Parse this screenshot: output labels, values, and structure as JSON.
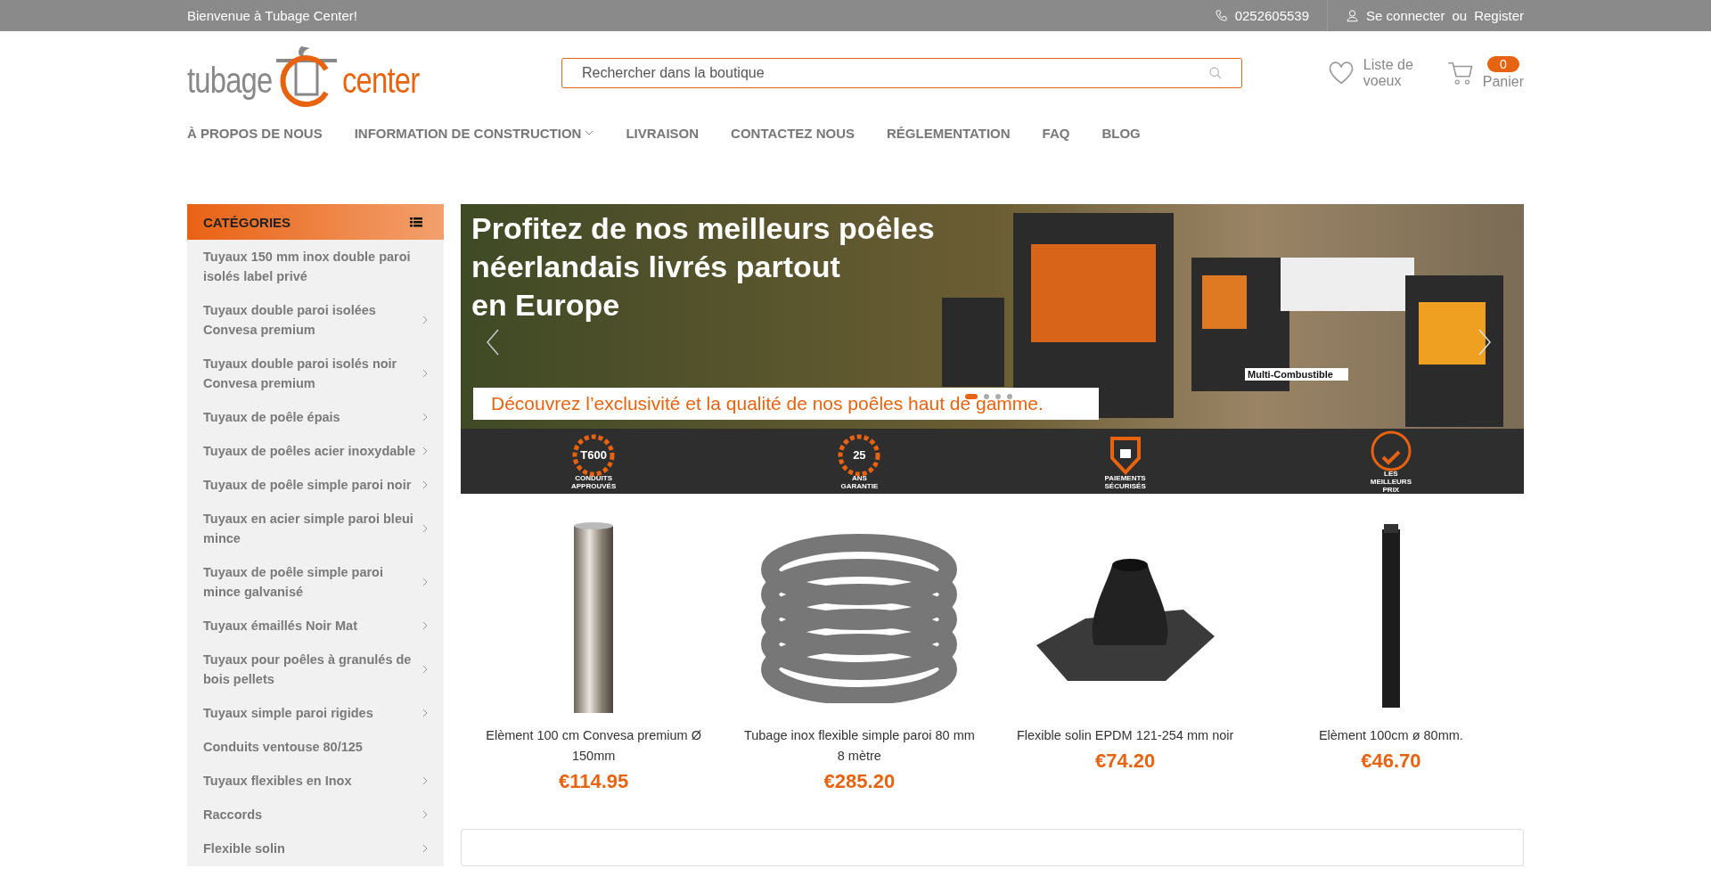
{
  "topbar": {
    "welcome": "Bienvenue à Tubage Center!",
    "phone": "0252605539",
    "login": "Se connecter",
    "or": "ou",
    "register": "Register"
  },
  "header": {
    "logo_left": "tubage",
    "logo_right": "center",
    "search": {
      "placeholder": "Rechercher dans la boutique"
    },
    "wishlist": "Liste de voeux",
    "cart_label": "Panier",
    "cart_count": "0"
  },
  "nav": [
    {
      "label": "À PROPOS DE NOUS",
      "dropdown": false
    },
    {
      "label": "INFORMATION DE CONSTRUCTION",
      "dropdown": true
    },
    {
      "label": "LIVRAISON",
      "dropdown": false
    },
    {
      "label": "CONTACTEZ NOUS",
      "dropdown": false
    },
    {
      "label": "RÉGLEMENTATION",
      "dropdown": false
    },
    {
      "label": "FAQ",
      "dropdown": false
    },
    {
      "label": "BLOG",
      "dropdown": false
    }
  ],
  "categories": {
    "title": "CATÉGORIES",
    "items": [
      {
        "label": "Tuyaux 150 mm inox double paroi isolés label privé",
        "has_children": false
      },
      {
        "label": "Tuyaux double paroi isolées Convesa premium",
        "has_children": true
      },
      {
        "label": "Tuyaux double paroi isolés noir Convesa premium",
        "has_children": true
      },
      {
        "label": "Tuyaux de poêle épais",
        "has_children": true
      },
      {
        "label": "Tuyaux de poêles acier inoxydable",
        "has_children": true
      },
      {
        "label": "Tuyaux de poêle simple paroi noir",
        "has_children": true
      },
      {
        "label": "Tuyaux en acier simple paroi bleui mince",
        "has_children": true
      },
      {
        "label": "Tuyaux de poêle simple paroi mince galvanisé",
        "has_children": true
      },
      {
        "label": "Tuyaux émaillés Noir Mat",
        "has_children": true
      },
      {
        "label": "Tuyaux pour poêles à granulés de bois pellets",
        "has_children": true
      },
      {
        "label": "Tuyaux simple paroi rigides",
        "has_children": true
      },
      {
        "label": "Conduits ventouse 80/125",
        "has_children": false
      },
      {
        "label": "Tuyaux flexibles en Inox",
        "has_children": true
      },
      {
        "label": "Raccords",
        "has_children": true
      },
      {
        "label": "Flexible solin",
        "has_children": true
      }
    ]
  },
  "banner": {
    "headline_lines": [
      "Profitez de nos meilleurs poêles",
      "néerlandais livrés partout",
      "en Europe"
    ],
    "subline": "Découvrez l’exclusivité et la qualité de nos poêles haut de gamme.",
    "tag": "Multi-Combustible",
    "dots": [
      {
        "selected": true
      },
      {
        "selected": false
      },
      {
        "selected": false
      },
      {
        "selected": false
      }
    ],
    "badges": [
      {
        "kind": "gear",
        "big": "T600",
        "lines": [
          "CONDUITS",
          "APPROUVÉS"
        ]
      },
      {
        "kind": "gear",
        "big": "25",
        "lines": [
          "ANS",
          "GARANTIE"
        ]
      },
      {
        "kind": "shield",
        "lines": [
          "PAIEMENTS",
          "SÉCURISÉS"
        ]
      },
      {
        "kind": "circle",
        "lines": [
          "LES",
          "MEILLEURS",
          "PRIX"
        ]
      }
    ]
  },
  "products": [
    {
      "kind": "pipe",
      "name": "Elèment 100 cm Convesa premium Ø 150mm",
      "price": "€114.95"
    },
    {
      "kind": "coil",
      "name": "Tubage inox flexible simple paroi 80 mm 8 mètre",
      "price": "€285.20"
    },
    {
      "kind": "flashing",
      "name": "Flexible solin EPDM 121-254 mm noir",
      "price": "€74.20"
    },
    {
      "kind": "blackpipe",
      "name": "Elèment 100cm ø 80mm.",
      "price": "€46.70"
    }
  ]
}
